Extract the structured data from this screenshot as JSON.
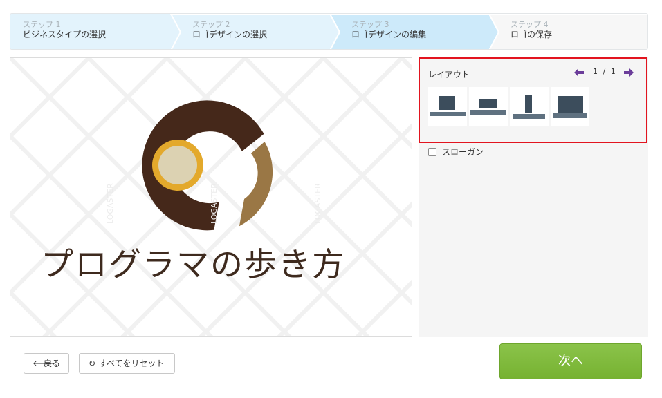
{
  "steps": [
    {
      "num": "ステップ 1",
      "label": "ビジネスタイプの選択"
    },
    {
      "num": "ステップ 2",
      "label": "ロゴデザインの選択"
    },
    {
      "num": "ステップ 3",
      "label": "ロゴデザインの編集"
    },
    {
      "num": "ステップ 4",
      "label": "ロゴの保存"
    }
  ],
  "preview": {
    "logo_text": "プログラマの歩き方",
    "watermark": "LOGASTER",
    "colors": {
      "dark_brown": "#45281a",
      "light_brown": "#9a7745",
      "gold": "#e3a92c",
      "cream": "#dcd2b2"
    }
  },
  "layout_panel": {
    "title": "レイアウト",
    "page_current": "1",
    "page_separator": "/",
    "page_total": "1",
    "prev_icon": "arrow-left-icon",
    "next_icon": "arrow-right-icon",
    "accent_color": "#6b3d9a",
    "highlight_color": "#e2141f"
  },
  "slogan": {
    "label": "スローガン",
    "checked": false
  },
  "buttons": {
    "back": "戻る",
    "reset": "すべてをリセット",
    "next": "次へ"
  },
  "colors": {
    "step_active": "#cdeafa",
    "step_done": "#e3f3fc",
    "next_green": "#7cb83a"
  }
}
